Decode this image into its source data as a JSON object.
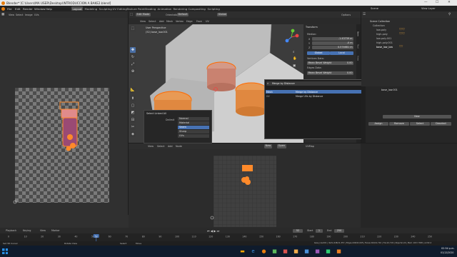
{
  "window": {
    "title": "Blender* [C:\\Users\\MA USER\\Desktop\\INTRODUCCION A BAKE2.blend]",
    "minimize": "—",
    "maximize": "☐",
    "close": "✕"
  },
  "menu": [
    "File",
    "Edit",
    "Render",
    "Window",
    "Help"
  ],
  "workspaces": [
    "Layout",
    "Modeling",
    "Sculpting",
    "UV Editing",
    "Texture Paint",
    "Shading",
    "Animation",
    "Rendering",
    "Compositing",
    "Scripting"
  ],
  "active_workspace": "Layout",
  "top_right": {
    "scene": "Scene",
    "view_layer": "View Layer"
  },
  "uv_editor": {
    "view": "View",
    "select": "Select",
    "image": "Image",
    "uvs": "UVs"
  },
  "viewport": {
    "mode": "Edit Mode",
    "menus": [
      "View",
      "Select",
      "Add",
      "Mesh",
      "Vertex",
      "Edge",
      "Face",
      "UV"
    ],
    "orientation_label": "Orientation:",
    "orientation": "Default",
    "pivot": "Global",
    "overlay_text": "User Perspective",
    "overlay_object": "(52) base_low.001",
    "options": "Options"
  },
  "operator_panel": {
    "title": "Select Linked All",
    "delimit_label": "Delimit",
    "options": [
      "Normal",
      "Material",
      "Seam",
      "Sharp",
      "UVs"
    ],
    "selected": "Seam"
  },
  "search_menu": {
    "query": "Merge by Distance",
    "categories": [
      "Mesh",
      "UV"
    ],
    "results": [
      "Merge by Distance",
      "Merge UVs by Distance"
    ],
    "selected": "Merge by Distance"
  },
  "transform_panel": {
    "title": "Transform",
    "median_label": "Median:",
    "x_label": "X",
    "x": "-1.43739 m",
    "y_label": "Y",
    "y": "-0 m",
    "z_label": "Z",
    "z": "0.574681 m",
    "space_tabs": [
      "Global",
      "Local"
    ],
    "vertices_data": "Vertices Data:",
    "mean_bevel_weight": "Mean Bevel Weight",
    "mean_bevel_weight_value": "0.00",
    "edges_data": "Edges Data:",
    "edge_bevel_weight_value": "0.00",
    "side_tabs": [
      "Item",
      "Tool",
      "View"
    ]
  },
  "outliner": {
    "title": "Scene Collection",
    "items": [
      "Collection",
      "low-poly",
      "high-poly",
      "low-poly.001",
      "high-poly.001",
      "base_low_low"
    ]
  },
  "properties": {
    "object": "base_low.001",
    "new": "New",
    "buttons": [
      "Assign",
      "Remove",
      "Select",
      "Deselect"
    ]
  },
  "image_editor": {
    "new": "New",
    "open": "Open",
    "uvmap": "UVMap",
    "view": "View",
    "select": "Select",
    "add": "Add",
    "node": "Node"
  },
  "timeline": {
    "menus": [
      "Playback",
      "Keying",
      "View",
      "Marker"
    ],
    "ticks": [
      0,
      10,
      20,
      30,
      40,
      50,
      52,
      60,
      70,
      80,
      90,
      100,
      110,
      120,
      130,
      140,
      150,
      160,
      170,
      180,
      190,
      200,
      210,
      220,
      230,
      240,
      250
    ],
    "current_frame": 52,
    "start_label": "Start",
    "start": "1",
    "end_label": "End",
    "end": "250"
  },
  "statusbar": {
    "left": [
      "Set 3D Cursor",
      "Rotate View",
      "Select",
      "Move"
    ],
    "right": "base_low.001 | Verts:448/11,357 | Edges:448/22,045 | Faces:224/10,710 | Tris:22,718 | Objects:1/6 | Mem: 263.7 MiB | v2.82.4"
  },
  "taskbar": {
    "time": "02:54 p.m.",
    "date": "01/12/2020"
  },
  "colors": {
    "selection_orange": "#ff8a2a",
    "accent_blue": "#4772b3",
    "header": "#2e2e2e",
    "background": "#1d1d1d"
  }
}
